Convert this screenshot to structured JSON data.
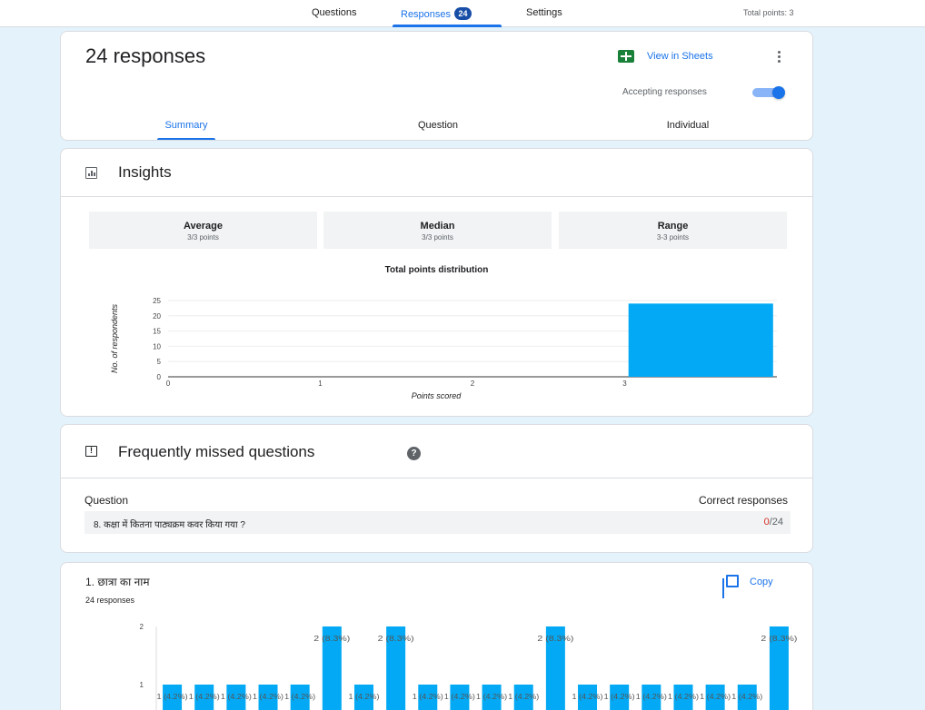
{
  "topnav": {
    "tabs": [
      {
        "label": "Questions"
      },
      {
        "label": "Responses",
        "badge": "24"
      },
      {
        "label": "Settings"
      }
    ],
    "total_points": "Total points: 3"
  },
  "header": {
    "title": "24 responses",
    "view_in_sheets": "View in Sheets",
    "accepting_label": "Accepting responses",
    "accepting": true,
    "subtabs": [
      "Summary",
      "Question",
      "Individual"
    ]
  },
  "insights": {
    "title": "Insights",
    "stats": [
      {
        "label": "Average",
        "value": "3/3 points"
      },
      {
        "label": "Median",
        "value": "3/3 points"
      },
      {
        "label": "Range",
        "value": "3-3 points"
      }
    ],
    "chart_title": "Total points distribution"
  },
  "missed": {
    "title": "Frequently missed questions",
    "col_question": "Question",
    "col_correct": "Correct responses",
    "rows": [
      {
        "question": "8. कक्षा में कितना पाठ्यक्रम कवर किया गया ?",
        "correct": "0",
        "total": "/24"
      }
    ]
  },
  "question1": {
    "title": "1. छात्रा का नाम",
    "count": "24 responses",
    "copy_label": "Copy"
  },
  "chart_data": [
    {
      "type": "bar",
      "title": "Total points distribution",
      "xlabel": "Points scored",
      "ylabel": "No. of respondents",
      "categories": [
        "0",
        "1",
        "2",
        "3"
      ],
      "values": [
        0,
        0,
        0,
        24
      ],
      "yticks": [
        "0",
        "5",
        "10",
        "15",
        "20",
        "25"
      ],
      "ylim": [
        0,
        25
      ],
      "color": "#03a9f4",
      "grid": true
    },
    {
      "type": "bar",
      "title": "",
      "values": [
        1,
        1,
        1,
        1,
        1,
        2,
        1,
        2,
        1,
        1,
        1,
        1,
        2,
        1,
        1,
        1,
        1,
        1,
        1,
        2
      ],
      "labels": [
        "1 (4.2%)",
        "1 (4.2%)",
        "1 (4.2%)",
        "1 (4.2%)",
        "1 (4.2%)",
        "2 (8.3%)",
        "1 (4.2%)",
        "2 (8.3%)",
        "1 (4.2%)",
        "1 (4.2%)",
        "1 (4.2%)",
        "1 (4.2%)",
        "2 (8.3%)",
        "1 (4.2%)",
        "1 (4.2%)",
        "1 (4.2%)",
        "1 (4.2%)",
        "1 (4.2%)",
        "1 (4.2%)",
        "2 (8.3%)"
      ],
      "yticks": [
        "1",
        "2"
      ],
      "ylim": [
        0,
        2
      ],
      "color": "#03a9f4"
    }
  ]
}
